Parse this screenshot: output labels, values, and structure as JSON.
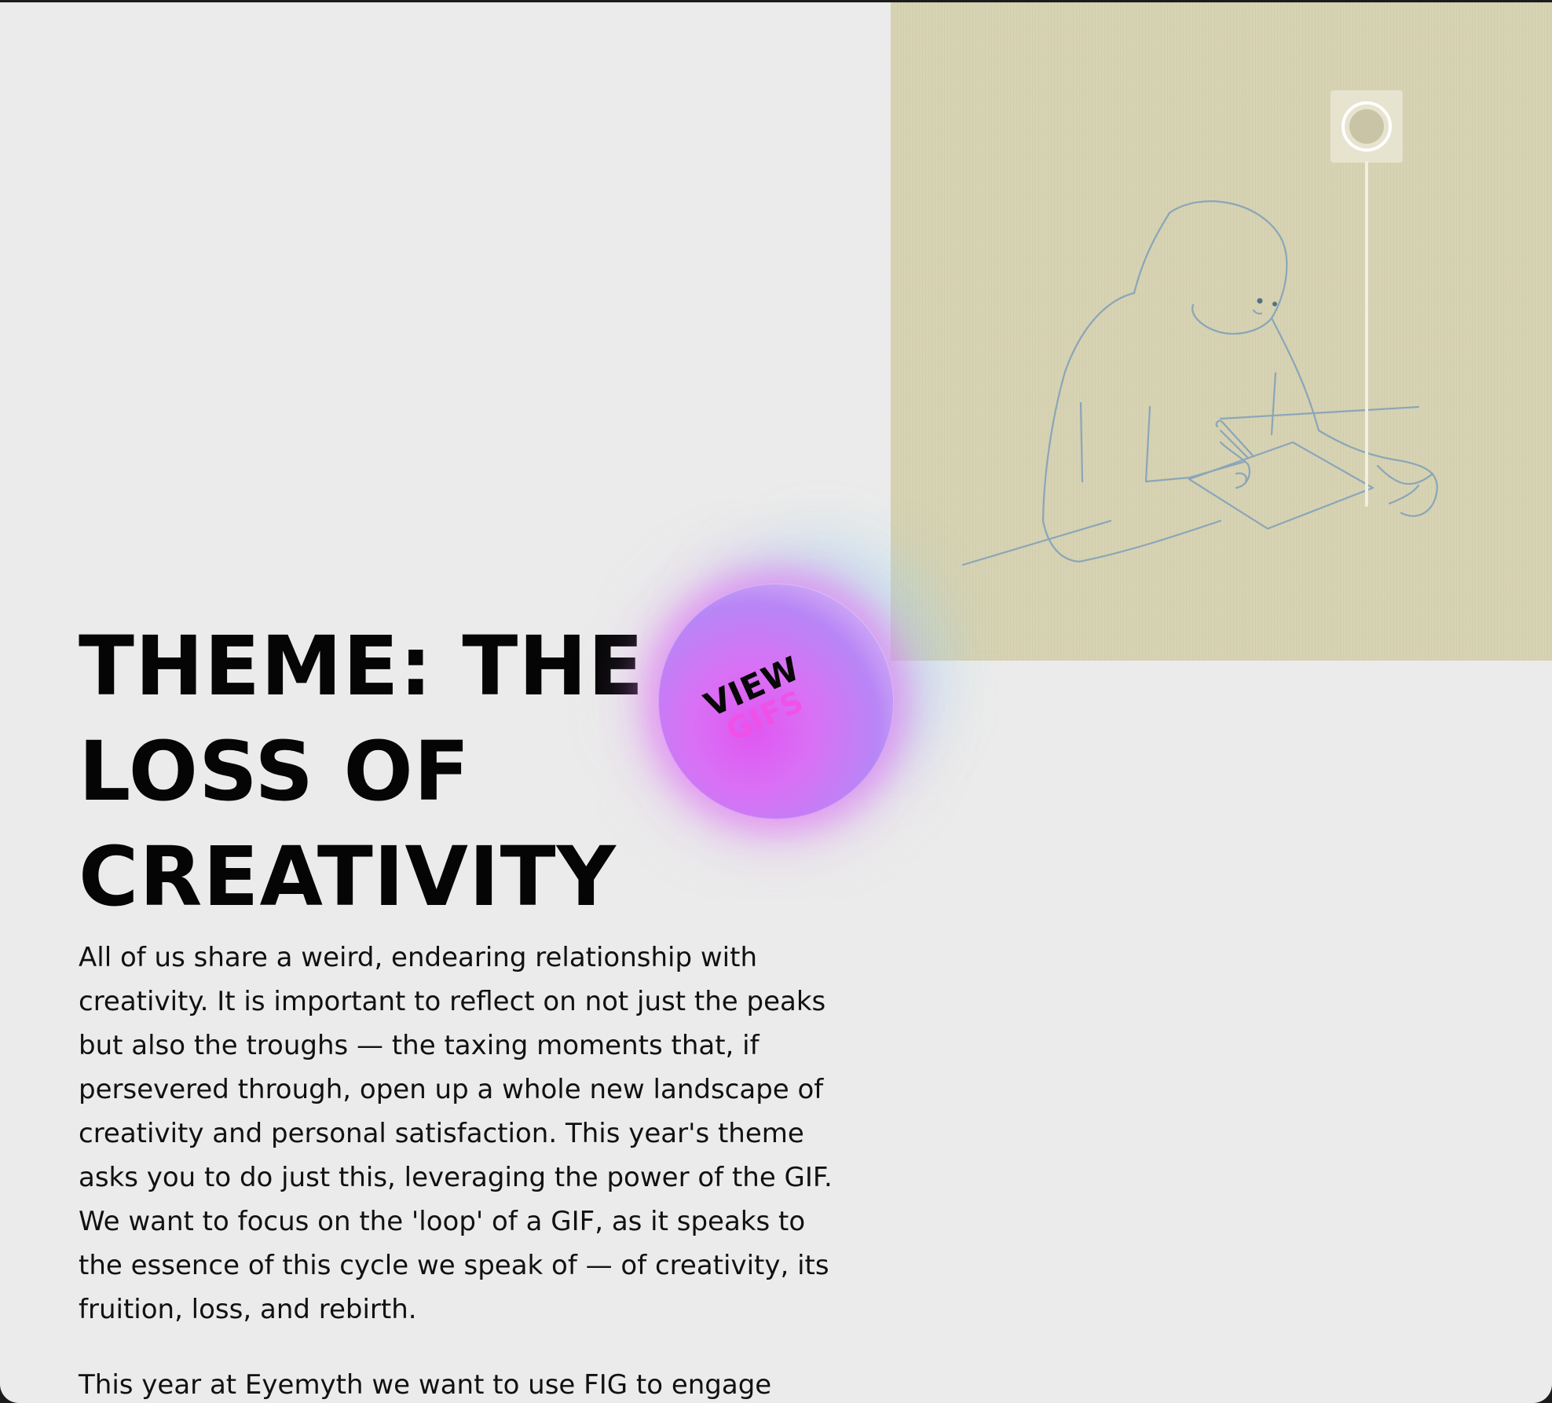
{
  "heading": {
    "line1": "THEME: THE",
    "line2": "LOSS OF",
    "line3": "CREATIVITY"
  },
  "body": {
    "paragraph1": "All of us share a weird, endearing relationship with creativity. It is important to reflect on not just the peaks but also the troughs — the taxing moments that, if persevered through, open up a whole new landscape of creativity and personal satisfaction. This year's theme asks you to do just this, leveraging the power of the GIF. We want to focus on the 'loop' of a GIF, as it speaks to the essence of this cycle we speak of — of creativity, its fruition, loss, and rebirth.",
    "paragraph2": "This year at Eyemyth we want to use FIG to engage"
  },
  "cta": {
    "line1": "VIEW",
    "line2": "GIFS"
  },
  "illustration": {
    "description_icon": "figure-drawing-illustration"
  },
  "colors": {
    "page_background": "#ebebeb",
    "illustration_background": "#d6d2b2",
    "line_art": "#8aa6b8",
    "cta_magenta": "#e056f2",
    "cta_purple": "#b886f6",
    "gifs_text": "#f24fe6"
  }
}
